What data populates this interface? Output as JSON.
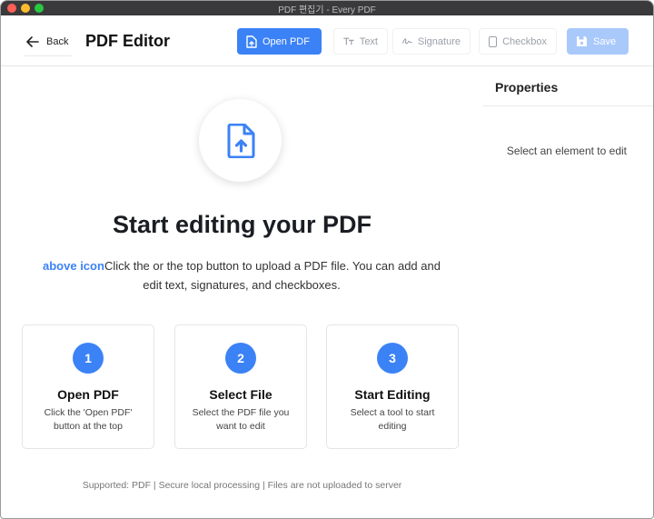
{
  "window": {
    "title": "PDF 편집기 - Every PDF"
  },
  "header": {
    "back_label": "Back",
    "title": "PDF Editor",
    "toolbar": {
      "open_label": "Open PDF",
      "text_label": "Text",
      "signature_label": "Signature",
      "checkbox_label": "Checkbox",
      "save_label": "Save"
    }
  },
  "main": {
    "hero": "Start editing your PDF",
    "desc_highlight": "above icon",
    "desc_text": "Click the or the top button to upload a PDF file. You can add and edit text, signatures, and checkboxes.",
    "steps": [
      {
        "number": "1",
        "title": "Open PDF",
        "desc": "Click the 'Open PDF' button at the top"
      },
      {
        "number": "2",
        "title": "Select File",
        "desc": "Select the PDF file you want to edit"
      },
      {
        "number": "3",
        "title": "Start Editing",
        "desc": "Select a tool to start editing"
      }
    ],
    "footer": "Supported: PDF | Secure local processing | Files are not uploaded to server"
  },
  "properties": {
    "title": "Properties",
    "empty": "Select an element to edit"
  },
  "colors": {
    "accent": "#3b82f6",
    "save_disabled": "#a9c9fb"
  }
}
